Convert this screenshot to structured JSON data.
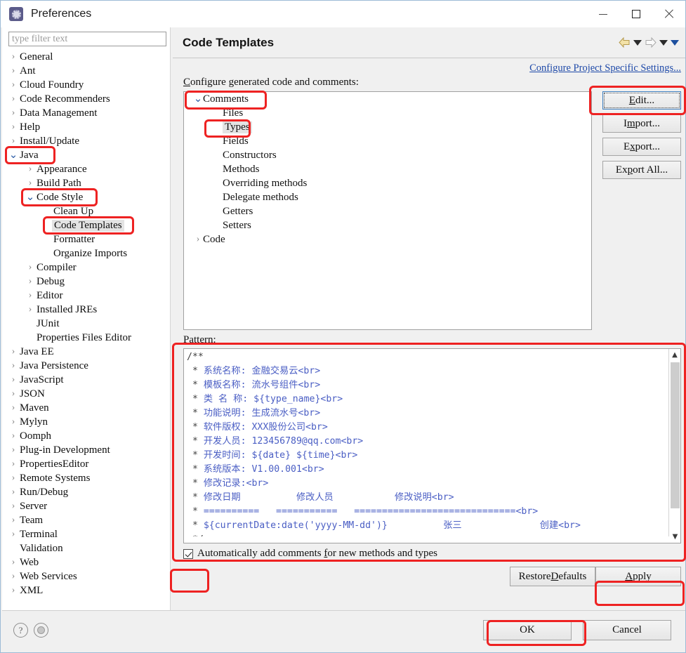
{
  "window": {
    "title": "Preferences",
    "icon": "preferences-gear-icon",
    "minimize_label": "minimize",
    "maximize_label": "maximize",
    "close_label": "close"
  },
  "sidebar": {
    "filter_placeholder": "type filter text",
    "filter_value": "",
    "items": [
      {
        "label": "General",
        "indent": 0,
        "arrow": "collapsed"
      },
      {
        "label": "Ant",
        "indent": 0,
        "arrow": "collapsed"
      },
      {
        "label": "Cloud Foundry",
        "indent": 0,
        "arrow": "collapsed"
      },
      {
        "label": "Code Recommenders",
        "indent": 0,
        "arrow": "collapsed"
      },
      {
        "label": "Data Management",
        "indent": 0,
        "arrow": "collapsed"
      },
      {
        "label": "Help",
        "indent": 0,
        "arrow": "collapsed"
      },
      {
        "label": "Install/Update",
        "indent": 0,
        "arrow": "collapsed"
      },
      {
        "label": "Java",
        "indent": 0,
        "arrow": "expanded",
        "highlighted": true
      },
      {
        "label": "Appearance",
        "indent": 1,
        "arrow": "collapsed"
      },
      {
        "label": "Build Path",
        "indent": 1,
        "arrow": "collapsed"
      },
      {
        "label": "Code Style",
        "indent": 1,
        "arrow": "expanded",
        "highlighted": true
      },
      {
        "label": "Clean Up",
        "indent": 2,
        "arrow": "none"
      },
      {
        "label": "Code Templates",
        "indent": 2,
        "arrow": "none",
        "selected": true,
        "highlighted": true
      },
      {
        "label": "Formatter",
        "indent": 2,
        "arrow": "none"
      },
      {
        "label": "Organize Imports",
        "indent": 2,
        "arrow": "none"
      },
      {
        "label": "Compiler",
        "indent": 1,
        "arrow": "collapsed"
      },
      {
        "label": "Debug",
        "indent": 1,
        "arrow": "collapsed"
      },
      {
        "label": "Editor",
        "indent": 1,
        "arrow": "collapsed"
      },
      {
        "label": "Installed JREs",
        "indent": 1,
        "arrow": "collapsed"
      },
      {
        "label": "JUnit",
        "indent": 1,
        "arrow": "none"
      },
      {
        "label": "Properties Files Editor",
        "indent": 1,
        "arrow": "none"
      },
      {
        "label": "Java EE",
        "indent": 0,
        "arrow": "collapsed"
      },
      {
        "label": "Java Persistence",
        "indent": 0,
        "arrow": "collapsed"
      },
      {
        "label": "JavaScript",
        "indent": 0,
        "arrow": "collapsed"
      },
      {
        "label": "JSON",
        "indent": 0,
        "arrow": "collapsed"
      },
      {
        "label": "Maven",
        "indent": 0,
        "arrow": "collapsed"
      },
      {
        "label": "Mylyn",
        "indent": 0,
        "arrow": "collapsed"
      },
      {
        "label": "Oomph",
        "indent": 0,
        "arrow": "collapsed"
      },
      {
        "label": "Plug-in Development",
        "indent": 0,
        "arrow": "collapsed"
      },
      {
        "label": "PropertiesEditor",
        "indent": 0,
        "arrow": "collapsed"
      },
      {
        "label": "Remote Systems",
        "indent": 0,
        "arrow": "collapsed"
      },
      {
        "label": "Run/Debug",
        "indent": 0,
        "arrow": "collapsed"
      },
      {
        "label": "Server",
        "indent": 0,
        "arrow": "collapsed"
      },
      {
        "label": "Team",
        "indent": 0,
        "arrow": "collapsed"
      },
      {
        "label": "Terminal",
        "indent": 0,
        "arrow": "collapsed"
      },
      {
        "label": "Validation",
        "indent": 0,
        "arrow": "none"
      },
      {
        "label": "Web",
        "indent": 0,
        "arrow": "collapsed"
      },
      {
        "label": "Web Services",
        "indent": 0,
        "arrow": "collapsed"
      },
      {
        "label": "XML",
        "indent": 0,
        "arrow": "collapsed"
      }
    ]
  },
  "page": {
    "title": "Code Templates",
    "project_link": "Configure Project Specific Settings...",
    "configure_label": "Configure generated code and comments:",
    "configure_label_mnemonic": "C",
    "nav": {
      "back_icon": "back-arrow-icon",
      "back_dropdown_icon": "chevron-down-icon",
      "forward_icon": "forward-arrow-icon",
      "forward_dropdown_icon": "chevron-down-icon",
      "menu_dropdown_icon": "chevron-down-icon"
    }
  },
  "template_tree": [
    {
      "label": "Comments",
      "indent": 0,
      "arrow": "expanded",
      "highlighted": true
    },
    {
      "label": "Files",
      "indent": 1,
      "arrow": "none"
    },
    {
      "label": "Types",
      "indent": 1,
      "arrow": "none",
      "selected": true,
      "highlighted": true
    },
    {
      "label": "Fields",
      "indent": 1,
      "arrow": "none"
    },
    {
      "label": "Constructors",
      "indent": 1,
      "arrow": "none"
    },
    {
      "label": "Methods",
      "indent": 1,
      "arrow": "none"
    },
    {
      "label": "Overriding methods",
      "indent": 1,
      "arrow": "none"
    },
    {
      "label": "Delegate methods",
      "indent": 1,
      "arrow": "none"
    },
    {
      "label": "Getters",
      "indent": 1,
      "arrow": "none"
    },
    {
      "label": "Setters",
      "indent": 1,
      "arrow": "none"
    },
    {
      "label": "Code",
      "indent": 0,
      "arrow": "collapsed"
    }
  ],
  "side_buttons": [
    {
      "label": "Edit...",
      "mnemonic": "E",
      "focused": true,
      "highlighted": true
    },
    {
      "label": "Import...",
      "mnemonic": "m",
      "focused": false
    },
    {
      "label": "Export...",
      "mnemonic": "x",
      "focused": false
    },
    {
      "label": "Export All...",
      "mnemonic": "p",
      "focused": false
    }
  ],
  "pattern": {
    "label": "Pattern:",
    "highlighted": true,
    "text": "/**\n * 系统名称: 金融交易云<br>\n * 模板名称: 流水号组件<br>\n * 类 名 称: ${type_name}<br>\n * 功能说明: 生成流水号<br>\n * 软件版权: XXX股份公司<br>\n * 开发人员: 123456789@qq.com<br>\n * 开发时间: ${date} ${time}<br>\n * 系统版本: V1.00.001<br>\n * 修改记录:<br>\n * 修改日期          修改人员           修改说明<br>\n * ==========   ===========   =============================<br>\n * ${currentDate:date('yyyy-MM-dd')}          张三              创建<br>\n */",
    "scrollbar_up_icon": "chevron-up-icon",
    "scrollbar_down_icon": "chevron-down-icon"
  },
  "checkbox": {
    "label": "Automatically add comments for new methods and types",
    "checked": true,
    "mnemonic": "f",
    "highlighted": true
  },
  "bottom_buttons": [
    {
      "label": "Restore Defaults",
      "mnemonic": "D",
      "highlighted": false
    },
    {
      "label": "Apply",
      "mnemonic": "A",
      "highlighted": true
    }
  ],
  "dialog_buttons": [
    {
      "label": "OK",
      "highlighted": true
    },
    {
      "label": "Cancel",
      "highlighted": false
    }
  ],
  "footer_icons": [
    {
      "name": "help-icon",
      "glyph": "?"
    },
    {
      "name": "status-circle-icon",
      "glyph": ""
    }
  ],
  "colors": {
    "highlight": "#ee2222",
    "link": "#1e49a8",
    "pattern_text": "#4a5ec4",
    "selection": "#e3e3e3",
    "panel_bg": "#f0f0f0"
  }
}
